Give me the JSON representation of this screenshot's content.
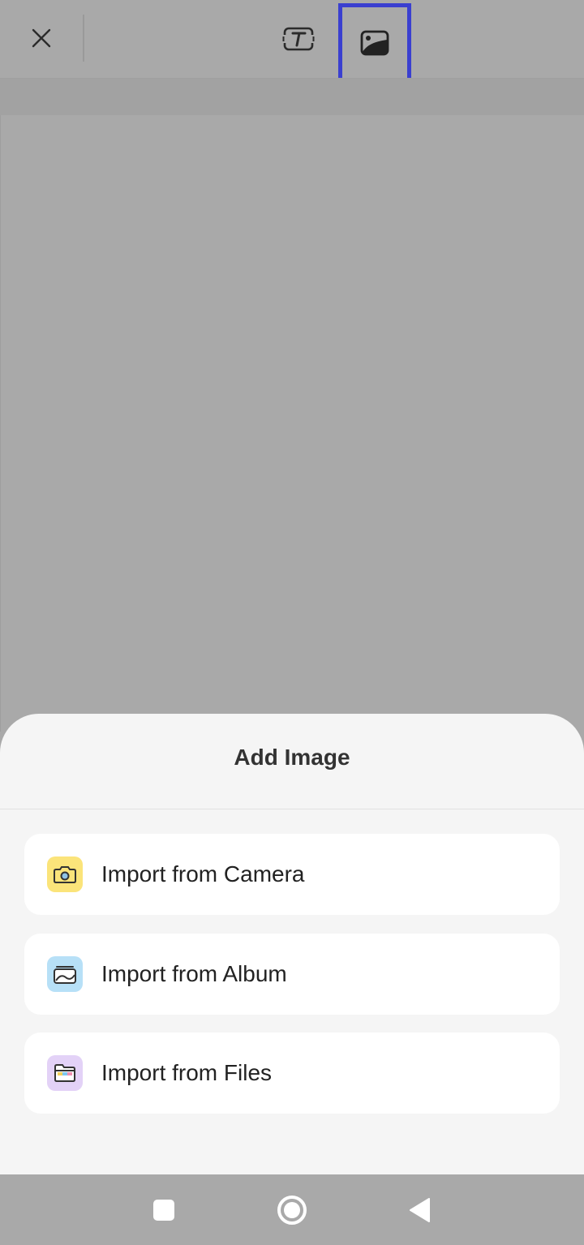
{
  "toolbar": {
    "close_icon": "close-icon",
    "text_tool_icon": "text-box-icon",
    "image_tool_icon": "image-icon",
    "selected_tool": "image",
    "highlight_color": "#3a3fd0",
    "active_underline_color": "#8b6fb4"
  },
  "sheet": {
    "title": "Add Image",
    "options": [
      {
        "label": "Import from Camera",
        "icon": "camera-icon",
        "icon_bg": "#fbe47a"
      },
      {
        "label": "Import from Album",
        "icon": "album-icon",
        "icon_bg": "#b7e0f7"
      },
      {
        "label": "Import from Files",
        "icon": "folder-icon",
        "icon_bg": "#e3d2f7"
      }
    ]
  },
  "navbar": {
    "recents_icon": "square-icon",
    "home_icon": "circle-icon",
    "back_icon": "triangle-back-icon"
  }
}
